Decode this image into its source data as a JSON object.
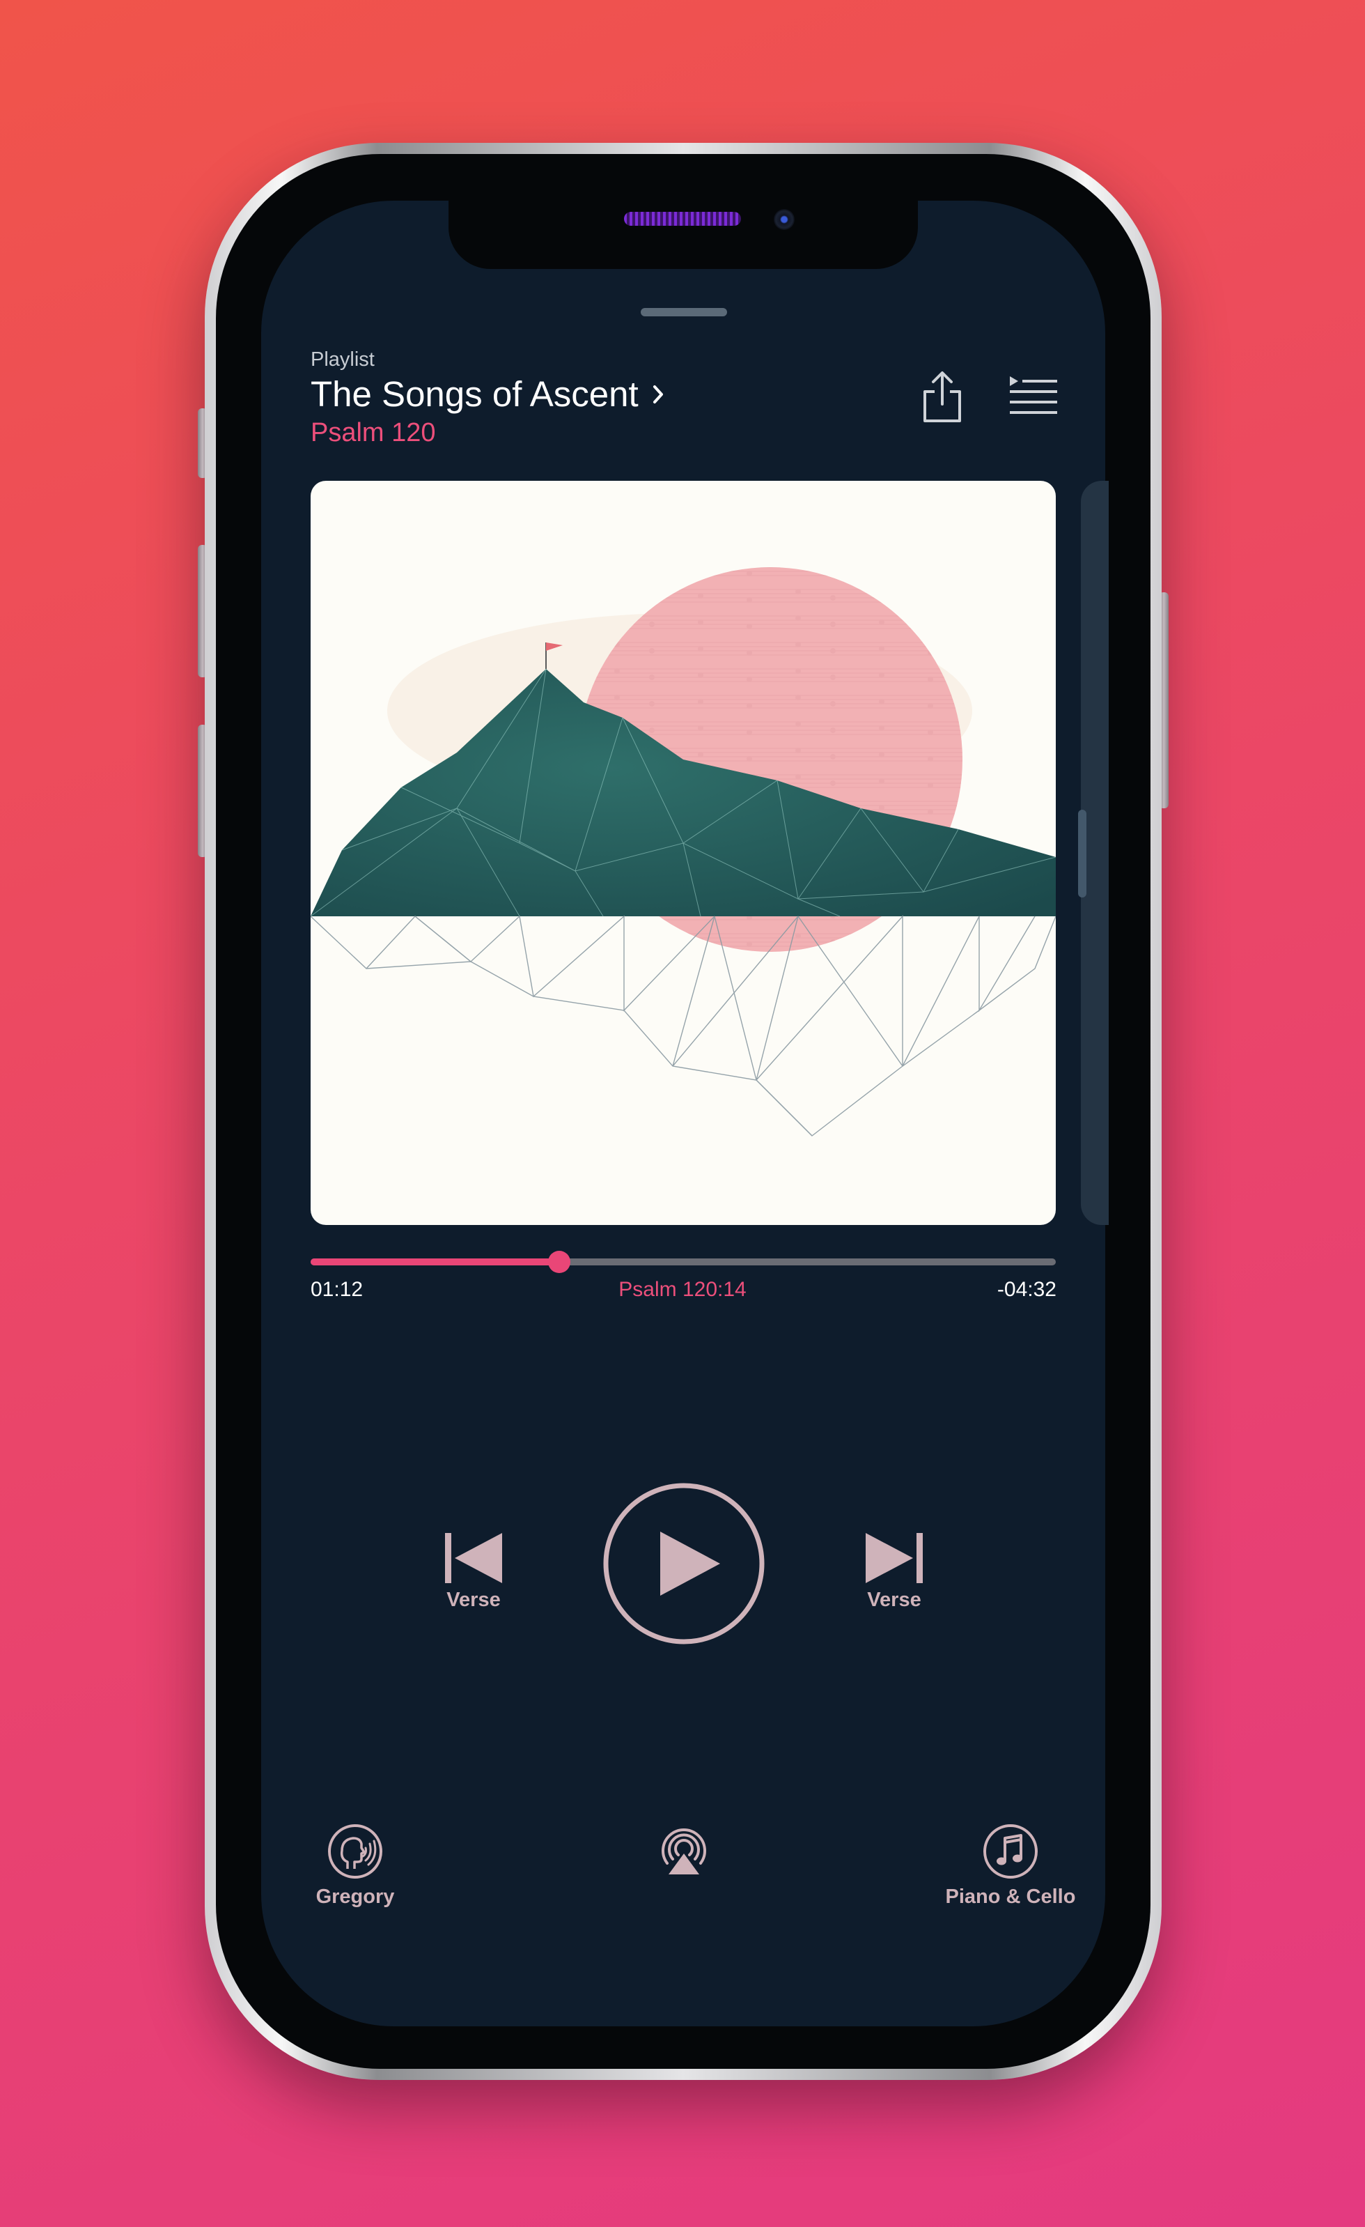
{
  "header": {
    "playlist_label": "Playlist",
    "playlist_title": "The Songs of Ascent",
    "track_name": "Psalm 120"
  },
  "icons": {
    "share": "share-icon",
    "queue": "queue-list-icon",
    "chevron": "chevron-right-icon",
    "previous": "skip-back-icon",
    "play": "play-icon",
    "next": "skip-forward-icon",
    "narrator": "singing-head-icon",
    "airplay": "airplay-icon",
    "music": "music-note-icon"
  },
  "progress": {
    "elapsed": "01:12",
    "reference": "Psalm 120:14",
    "remaining": "-04:32",
    "fraction": 0.334
  },
  "controls": {
    "previous_label": "Verse",
    "next_label": "Verse"
  },
  "bottom_bar": {
    "narrator_label": "Gregory",
    "music_label": "Piano & Cello"
  },
  "colors": {
    "screen_bg": "#0e1c2c",
    "accent": "#e94677",
    "control": "#cfb3ba"
  }
}
